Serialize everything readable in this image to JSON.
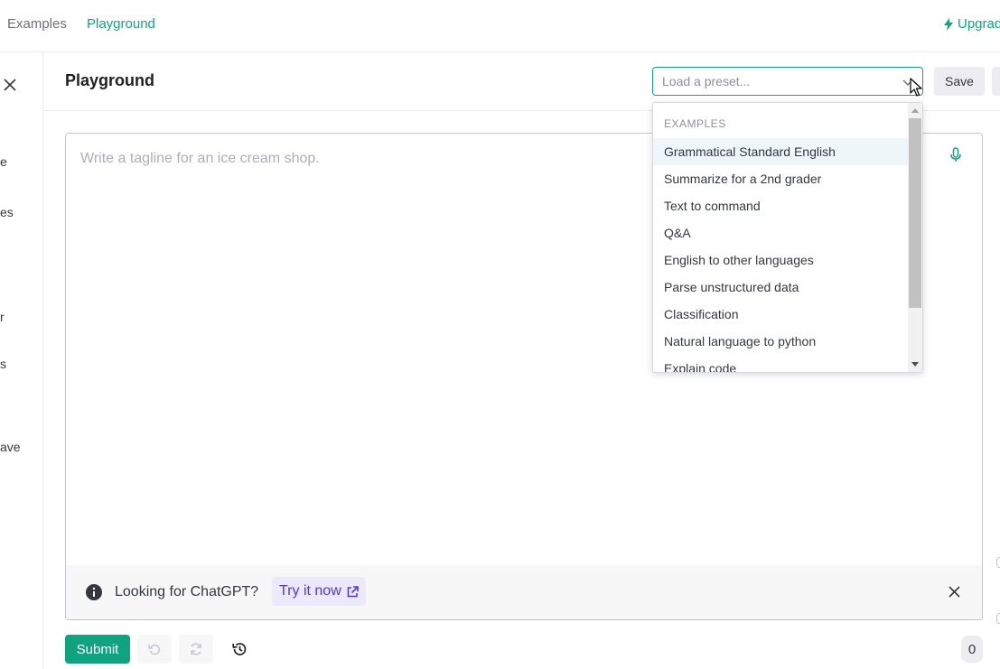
{
  "nav": {
    "examples_label": "Examples",
    "playground_label": "Playground",
    "upgrade_label": "Upgrad"
  },
  "sidebar": {
    "fragments": [
      "e",
      "es",
      "r",
      "s",
      "ave"
    ]
  },
  "header": {
    "title": "Playground",
    "preset_placeholder": "Load a preset...",
    "save_label": "Save"
  },
  "editor": {
    "placeholder": "Write a tagline for an ice cream shop.",
    "banner_text": "Looking for ChatGPT?",
    "banner_link": "Try it now"
  },
  "toolbar": {
    "submit_label": "Submit",
    "token_count": "0"
  },
  "dropdown": {
    "group_label": "EXAMPLES",
    "options": [
      "Grammatical Standard English",
      "Summarize for a 2nd grader",
      "Text to command",
      "Q&A",
      "English to other languages",
      "Parse unstructured data",
      "Classification",
      "Natural language to python",
      "Explain code"
    ]
  },
  "colors": {
    "accent": "#10a37f",
    "link_purple": "#5436da",
    "highlight": "#eef6f9"
  }
}
